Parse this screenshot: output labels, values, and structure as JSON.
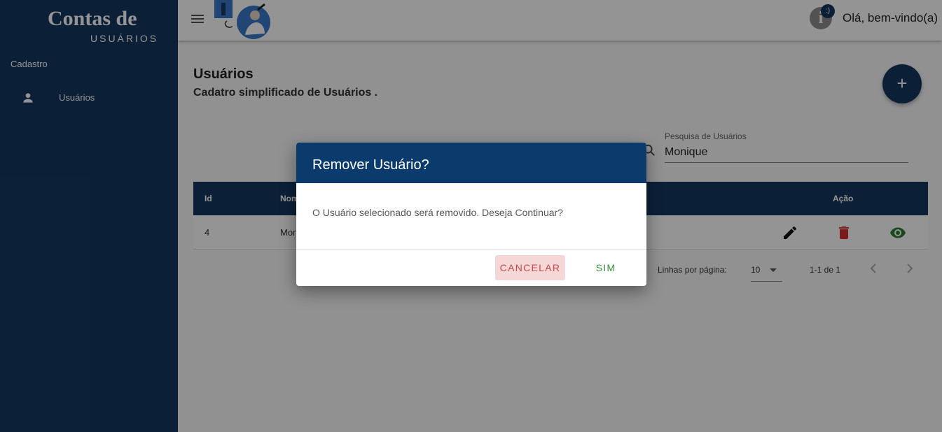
{
  "sidebar": {
    "brand_title": "Contas de",
    "brand_subtitle": "USUÁRIOS",
    "section": "Cadastro",
    "items": [
      {
        "label": "Usuários",
        "icon": "person-icon"
      }
    ]
  },
  "topbar": {
    "greeting": "Olá, bem-vindo(a)",
    "info_icon_text": "i",
    "info_badge": ":)"
  },
  "page": {
    "title": "Usuários",
    "subtitle": "Cadatro simplificado de Usuários ."
  },
  "search": {
    "label": "Pesquisa de Usuários",
    "value": "Monique"
  },
  "table": {
    "columns": [
      "Id",
      "Nom",
      "Ação"
    ],
    "rows": [
      {
        "id": "4",
        "name": "Mor"
      }
    ]
  },
  "pagination": {
    "rows_per_page_label": "Linhas por página:",
    "rows_per_page": "10",
    "range": "1-1 de 1"
  },
  "dialog": {
    "title": "Remover Usuário?",
    "message": "O Usuário selecionado será removido. Deseja Continuar?",
    "cancel_label": "CANCELAR",
    "confirm_label": "SIM"
  },
  "colors": {
    "primary": "#14375f",
    "dialog_header": "#0b3a6c",
    "danger": "#d32f2f",
    "success": "#2e7d32",
    "cancel_bg": "#f6d7d7"
  }
}
